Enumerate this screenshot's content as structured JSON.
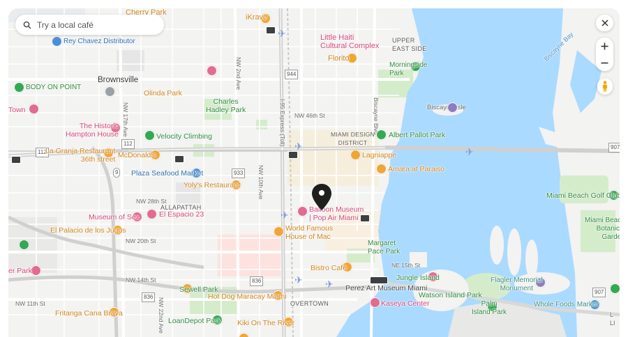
{
  "search": {
    "placeholder": "Try a local café"
  },
  "controls": {
    "close": "close",
    "zoom_in": "zoom in",
    "zoom_out": "zoom out",
    "pegman": "street view"
  },
  "colors": {
    "water": "#aadaff",
    "park": "#c8e6b4",
    "road": "#ffffff",
    "highway": "#d9d9d9",
    "land": "#f3f3f1"
  },
  "areas": {
    "brownsville": "Brownsville",
    "little_haiti": "Little Haiti\nCultural Complex",
    "upper_east_side": "UPPER\nEAST SIDE",
    "miami_design": "MIAMI DESIGN\nDISTRICT",
    "allapattah": "ALLAPATTAH",
    "overtown": "OVERTOWN",
    "biscayne_isle": "Biscayne Isle"
  },
  "streets": {
    "nw_46th": "NW 46th St",
    "nw_28th": "NW 28th St",
    "nw_20th": "NW 20th St",
    "nw_14th": "NW 14th St",
    "nw_11th": "NW 11th St",
    "nw_22nd_ave": "NW 22nd Ave",
    "nw_17th_ave": "NW 17th Ave",
    "nw_10th_ave": "NW 10th Ave",
    "nw_2nd_ave": "NW 2nd Ave",
    "ne_15th": "NE 15th St",
    "biscayne_blvd": "Biscayne Blvd",
    "biscayne_bay": "Biscayne Bay",
    "i95": "I-95 Express (Toll)",
    "shield_944": "944",
    "shield_112": "112",
    "shield_9": "9",
    "shield_933": "933",
    "shield_836": "836",
    "shield_907": "907"
  },
  "pois": {
    "cherry_park": "Cherry Park",
    "ikrave": "iKrave",
    "rey_chavez": "Rey Chavez Distributor",
    "florito": "Florito",
    "morningside": "Morningside\nPark",
    "body_on_point": "BODY ON POINT",
    "olinda_park": "Olinda Park",
    "charles_hadley": "Charles\nHadley Park",
    "town": "Town",
    "historic_hampton": "The Historic\nHampton House",
    "velocity": "Velocity Climbing",
    "albert_pallot": "Albert Pallot Park",
    "la_granja": "La Granja Restaurant\n36th street",
    "mcdonalds": "McDonald's",
    "lagniappe": "Lagniappe",
    "plaza_seafood": "Plaza Seafood Market",
    "amara": "Amara at Paraiso",
    "yolys": "Yoly's Restaurant",
    "balloon_museum": "Balloon Museum\n| Pop Air Miami",
    "museum_of_sex": "Museum of Sex",
    "espacio": "El Espacio 23",
    "world_famous": "World Famous\nHouse of Mac",
    "palacio": "El Palacio de los Jugos",
    "margaret_pace": "Margaret\nPace Park",
    "miami_beach_golf": "Miami Beach Golf Club",
    "miami_beach_botanical": "Miami Beach\nBotanical\nGarden",
    "bistro_cafe": "Bistro Café",
    "er_park": "er Park",
    "jungle_island": "Jungle Island",
    "flagler": "Flagler Memorial\nMonument",
    "sewell_park": "Sewell Park",
    "hot_dog": "Hot Dog Maracay Miami",
    "perez_art": "Perez Art Museum Miami",
    "watson_island": "Watson Island Park",
    "kaseya": "Kaseya Center",
    "palm_island": "Palm\nIsland Park",
    "whole_foods": "Whole Foods Market",
    "fritanga": "Fritanga Cana Brava",
    "loandepot": "LoanDepot Park",
    "kiki": "Kiki On The River",
    "lima": "L\nLI"
  }
}
